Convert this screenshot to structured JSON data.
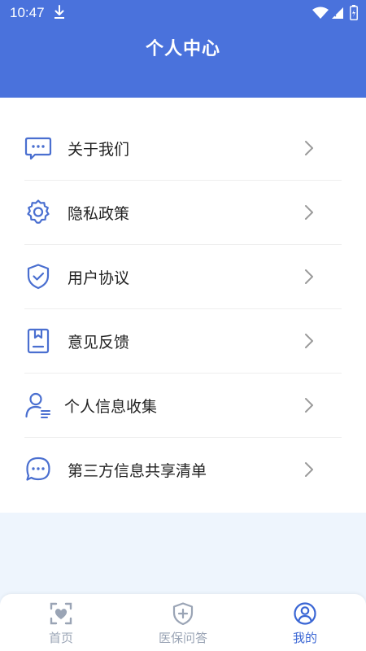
{
  "status_bar": {
    "time": "10:47",
    "icons": [
      "download-icon",
      "wifi-icon",
      "signal-icon",
      "battery-icon"
    ]
  },
  "header": {
    "title": "个人中心"
  },
  "menu": {
    "items": [
      {
        "label": "关于我们",
        "icon": "message-icon"
      },
      {
        "label": "隐私政策",
        "icon": "gear-icon"
      },
      {
        "label": "用户协议",
        "icon": "shield-check-icon"
      },
      {
        "label": "意见反馈",
        "icon": "feedback-icon"
      },
      {
        "label": "个人信息收集",
        "icon": "user-list-icon"
      },
      {
        "label": "第三方信息共享清单",
        "icon": "chat-dots-icon"
      }
    ]
  },
  "bottom_nav": {
    "items": [
      {
        "label": "首页",
        "icon": "home-heart-icon",
        "active": false
      },
      {
        "label": "医保问答",
        "icon": "shield-plus-icon",
        "active": false
      },
      {
        "label": "我的",
        "icon": "user-circle-icon",
        "active": true
      }
    ]
  },
  "colors": {
    "header_bg": "#4a72dc",
    "icon_accent": "#4a6fd0",
    "active_tab": "#3a66d4",
    "inactive_tab": "#9aa4b5",
    "page_bg": "#eef5fd"
  }
}
